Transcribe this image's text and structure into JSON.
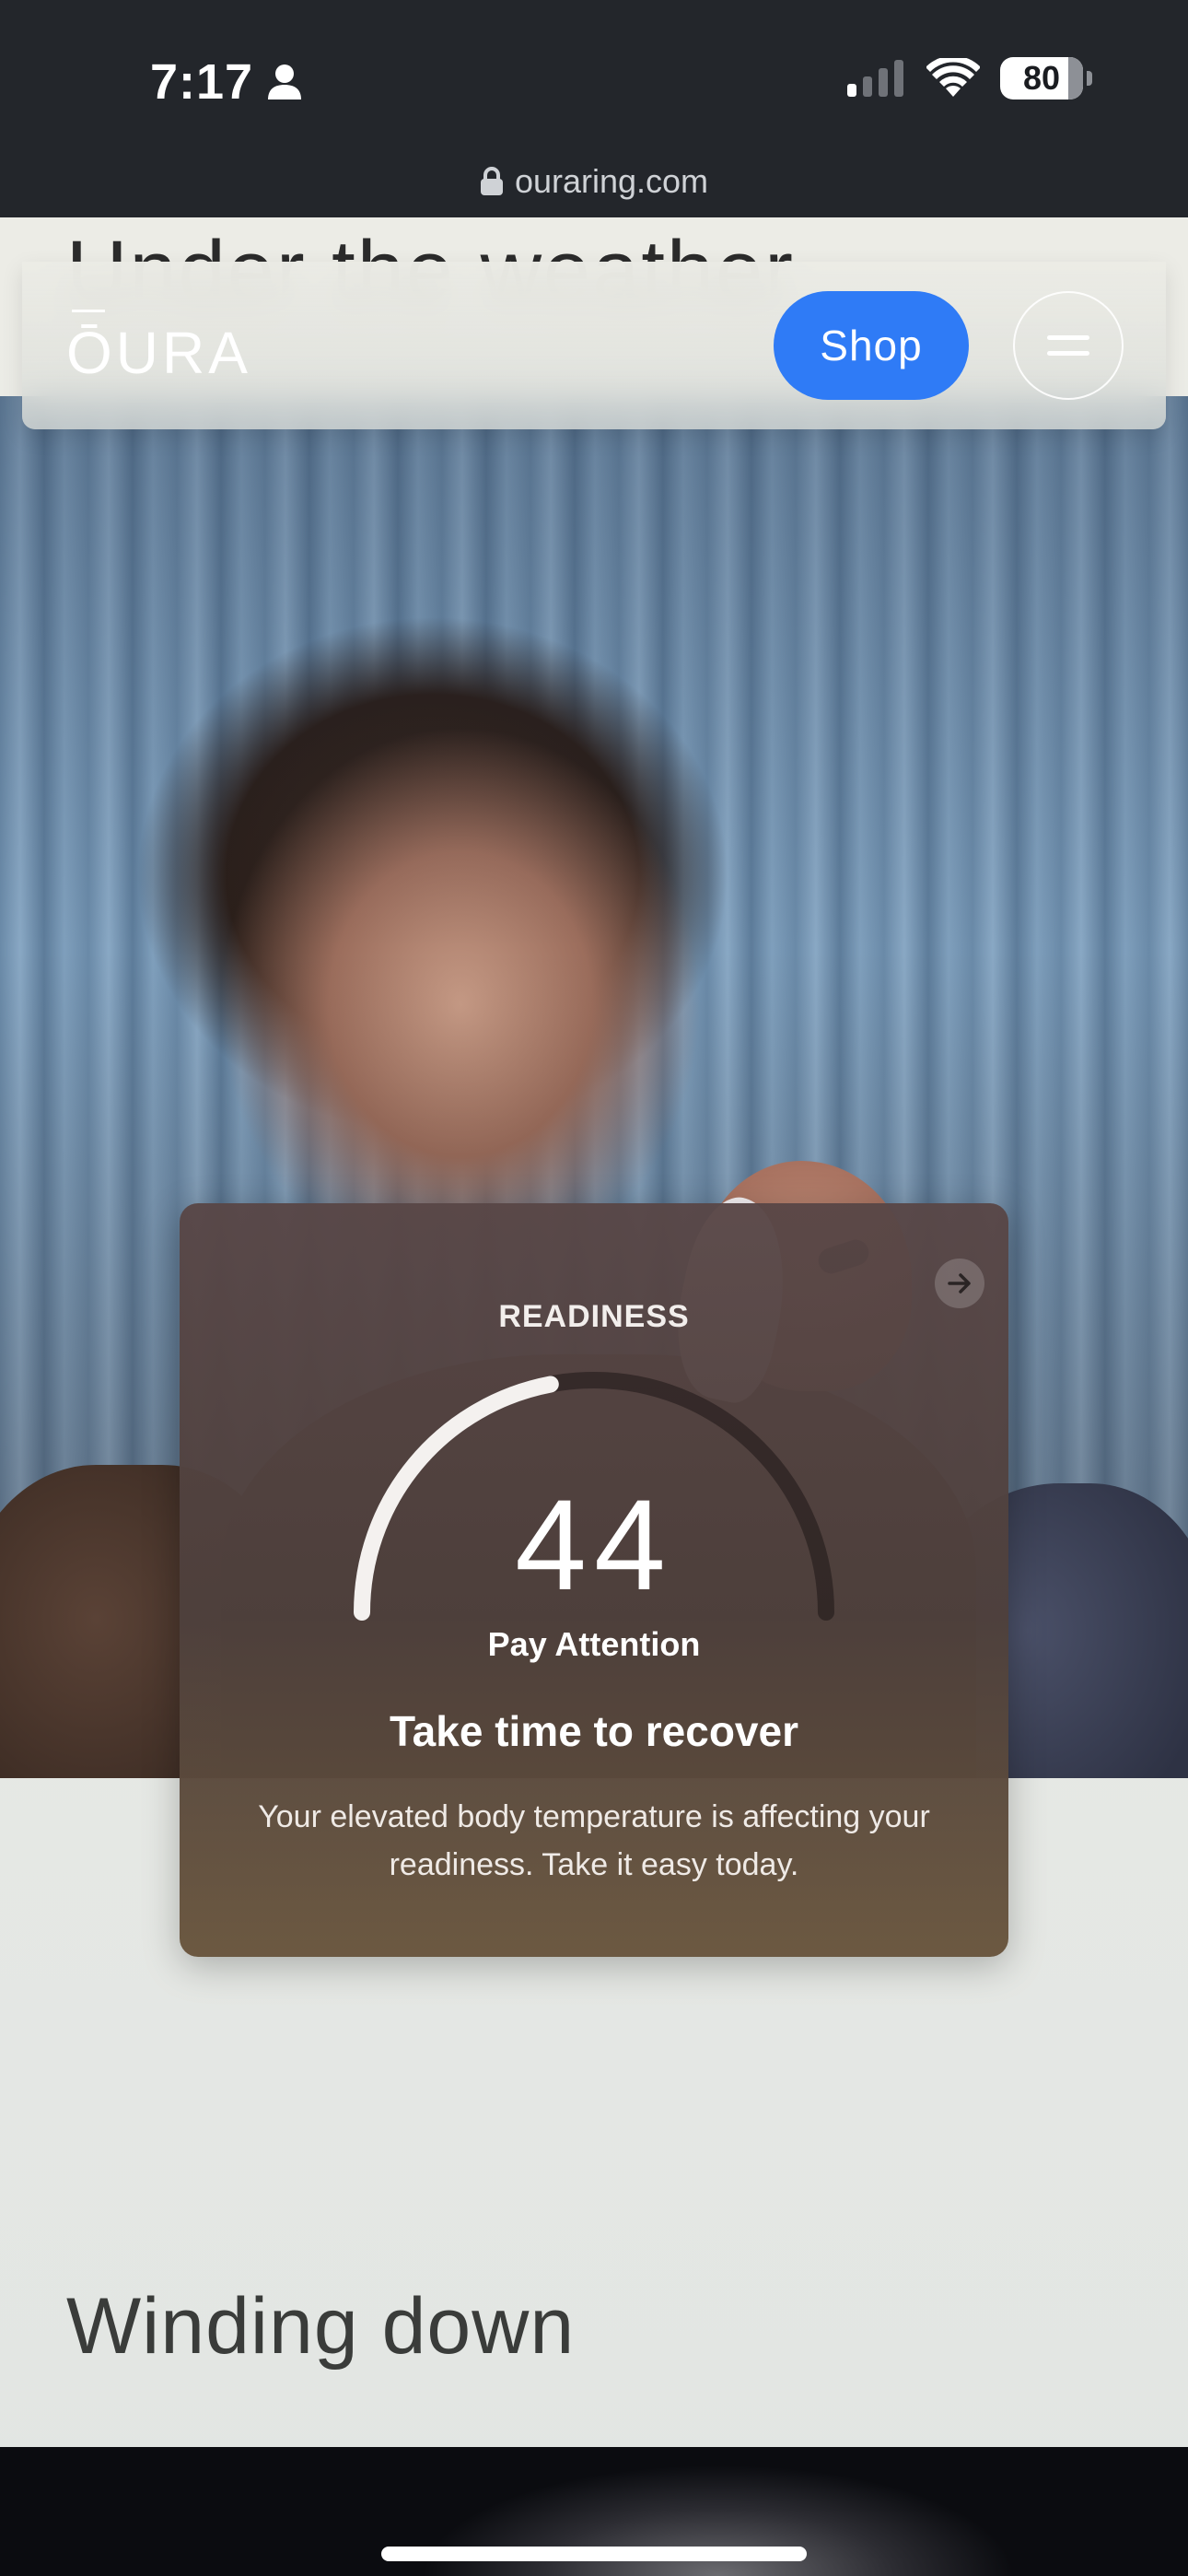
{
  "status_bar": {
    "time": "7:17",
    "battery": "80"
  },
  "browser": {
    "url": "ouraring.com"
  },
  "header": {
    "logo": "ŌURA",
    "shop_label": "Shop"
  },
  "previous_section": {
    "heading": "Under the weather"
  },
  "readiness_card": {
    "label": "READINESS",
    "score": "44",
    "score_fraction": 0.44,
    "status": "Pay Attention",
    "title": "Take time to recover",
    "body": "Your elevated body temperature is affecting your readiness. Take it easy today."
  },
  "next_section": {
    "heading": "Winding down"
  },
  "icons": {
    "person": "person-icon",
    "signal": "cellular-signal-icon",
    "wifi": "wifi-icon",
    "lock": "lock-icon",
    "menu": "hamburger-menu-icon",
    "arrow": "arrow-right-icon"
  },
  "colors": {
    "accent": "#2f7bf6",
    "status_bar_bg": "#23262b"
  }
}
